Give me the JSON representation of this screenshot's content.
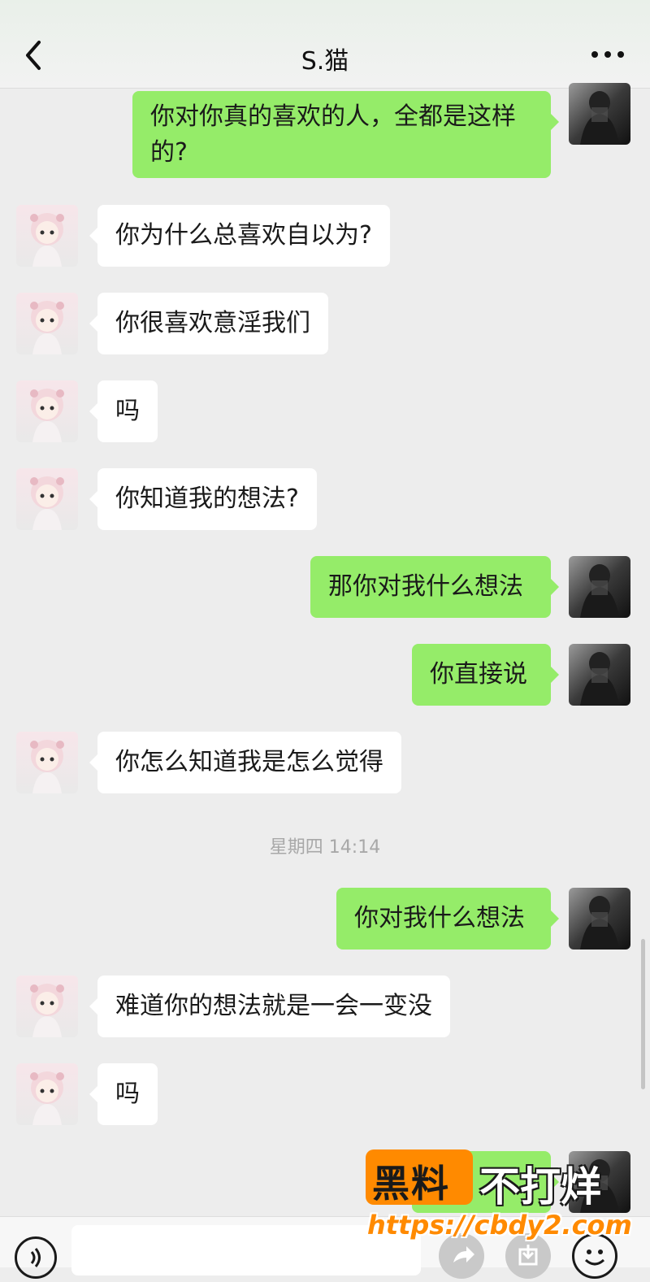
{
  "header": {
    "title": "S.猫",
    "back_icon": "chevron-left-icon",
    "more_icon": "more-dots-icon"
  },
  "messages": [
    {
      "side": "right",
      "text_lines": [
        "你对你真的喜欢的人，全都是这样",
        "的?"
      ]
    },
    {
      "side": "left",
      "text": "你为什么总喜欢自以为?"
    },
    {
      "side": "left",
      "text": "你很喜欢意淫我们"
    },
    {
      "side": "left",
      "text": "吗"
    },
    {
      "side": "left",
      "text": "你知道我的想法?"
    },
    {
      "side": "right",
      "text": "那你对我什么想法"
    },
    {
      "side": "right",
      "text": "你直接说"
    },
    {
      "side": "left",
      "text": "你怎么知道我是怎么觉得"
    },
    {
      "side": "right",
      "text": "你对我什么想法"
    },
    {
      "side": "left",
      "text": "难道你的想法就是一会一变没"
    },
    {
      "side": "left",
      "text": "吗"
    }
  ],
  "timestamp": "星期四 14:14",
  "bottom_bar": {
    "voice_icon": "voice-icon",
    "buttons": [
      "share-icon",
      "download-icon",
      "emoji-icon"
    ]
  },
  "watermark": {
    "logo_text": "黑料",
    "slogan": "不打烊",
    "url": "https://cbdy2.com"
  },
  "colors": {
    "green_bubble": "#95ec69",
    "white_bubble": "#ffffff",
    "background": "#ededed"
  }
}
